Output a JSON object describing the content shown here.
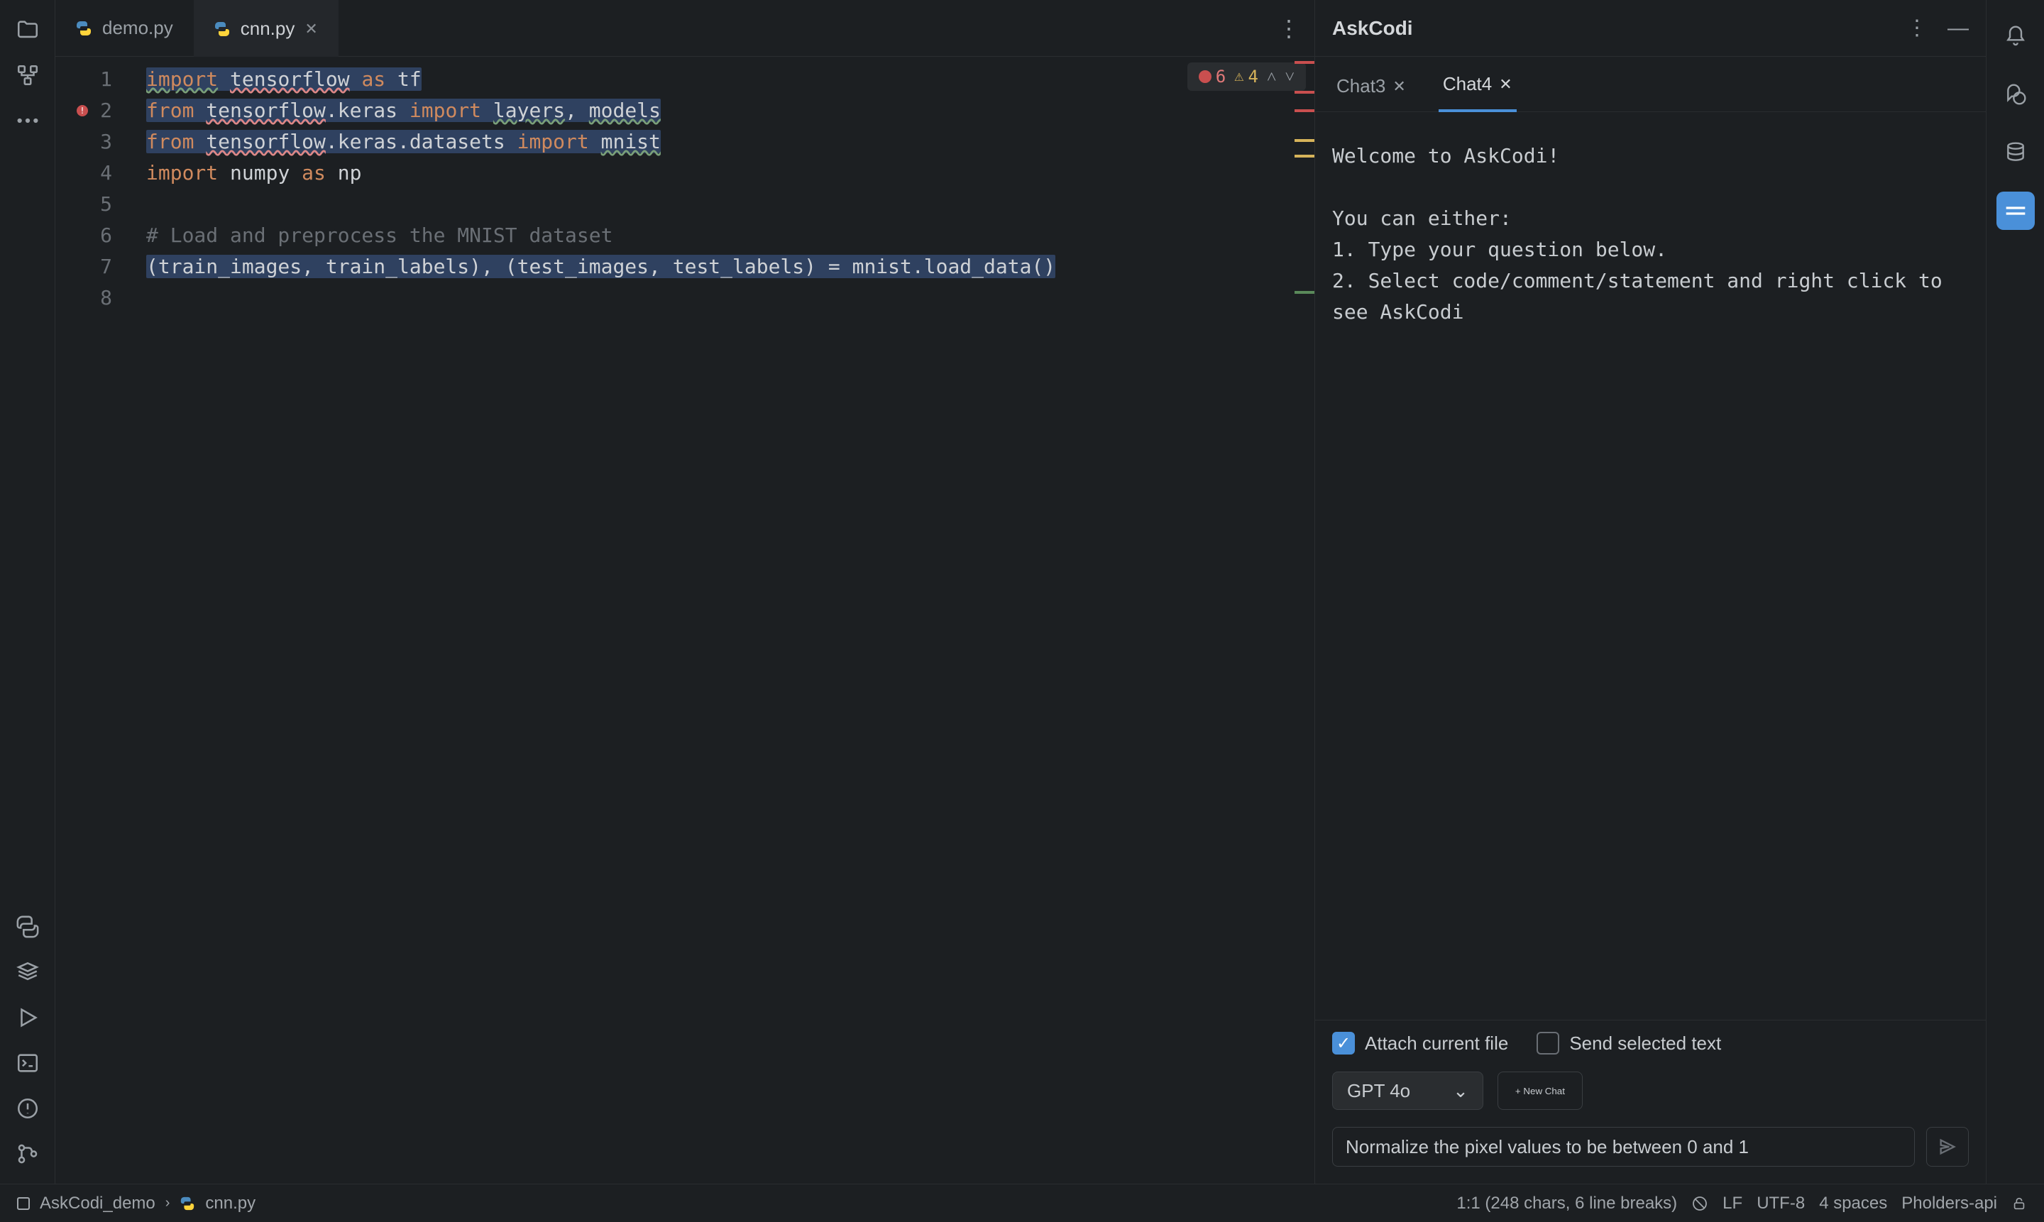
{
  "tabs": [
    {
      "label": "demo.py",
      "active": false
    },
    {
      "label": "cnn.py",
      "active": true
    }
  ],
  "diagnostics": {
    "errors": "6",
    "warnings": "4"
  },
  "gutter": [
    "1",
    "2",
    "3",
    "4",
    "5",
    "6",
    "7",
    "8"
  ],
  "code": {
    "l1_import": "import",
    "l1_tf": "tensorflow",
    "l1_as": "as",
    "l1_alias": "tf",
    "l2_from": "from",
    "l2_tf": "tensorflow",
    "l2_rest1": ".keras ",
    "l2_import": "import",
    "l2_layers": "layers",
    "l2_comma": ", ",
    "l2_models": "models",
    "l3_from": "from",
    "l3_tf": "tensorflow",
    "l3_rest": ".keras.datasets ",
    "l3_import": "import",
    "l3_mnist": "mnist",
    "l4_import": "import",
    "l4_numpy": "numpy",
    "l4_as": "as",
    "l4_np": "np",
    "l6_cm": "# Load and preprocess the MNIST dataset",
    "l7": "(train_images, train_labels), (test_images, test_labels) = mnist.load_data()"
  },
  "askcodi": {
    "title": "AskCodi",
    "tabs": [
      {
        "label": "Chat3",
        "active": false
      },
      {
        "label": "Chat4",
        "active": true
      }
    ],
    "welcome": "Welcome to AskCodi!",
    "intro": "You can either:",
    "opt1": "1. Type your question below.",
    "opt2": "2. Select code/comment/statement and right click to see AskCodi",
    "attach_label": "Attach current file",
    "send_sel_label": "Send selected text",
    "model": "GPT 4o",
    "new_chat": "+ New Chat",
    "input_value": "Normalize the pixel values to be between 0 and 1"
  },
  "status": {
    "project": "AskCodi_demo",
    "file": "cnn.py",
    "pos": "1:1 (248 chars, 6 line breaks)",
    "eol": "LF",
    "enc": "UTF-8",
    "indent": "4 spaces",
    "right": "Pholders-api"
  }
}
